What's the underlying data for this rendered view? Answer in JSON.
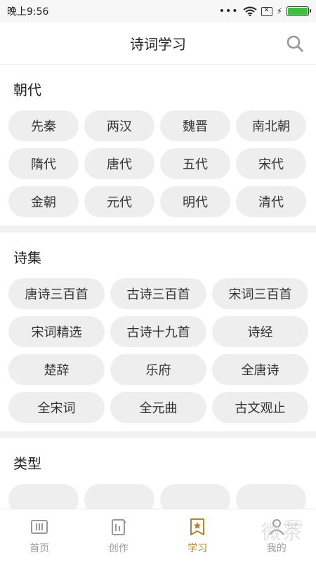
{
  "status_bar": {
    "time": "晚上9:56",
    "dots": "•••",
    "sim_label": "✕",
    "bolt": "⚡"
  },
  "header": {
    "title": "诗词学习",
    "search_icon": "search-icon"
  },
  "sections": [
    {
      "title": "朝代",
      "items": [
        "先秦",
        "两汉",
        "魏晋",
        "南北朝",
        "隋代",
        "唐代",
        "五代",
        "宋代",
        "金朝",
        "元代",
        "明代",
        "清代"
      ]
    },
    {
      "title": "诗集",
      "items": [
        "唐诗三百首",
        "古诗三百首",
        "宋词三百首",
        "宋词精选",
        "古诗十九首",
        "诗经",
        "楚辞",
        "乐府",
        "全唐诗",
        "全宋词",
        "全元曲",
        "古文观止"
      ]
    },
    {
      "title": "类型",
      "items": [
        "",
        "",
        "",
        ""
      ]
    }
  ],
  "tabs": [
    {
      "label": "首页",
      "icon": "home-icon",
      "active": false
    },
    {
      "label": "创作",
      "icon": "edit-icon",
      "active": false
    },
    {
      "label": "学习",
      "icon": "study-icon",
      "active": true
    },
    {
      "label": "我的",
      "icon": "profile-icon",
      "active": false
    }
  ],
  "watermark": {
    "text": "微茶",
    "badge": "CHA"
  },
  "colors": {
    "accent": "#b8832f",
    "chip_bg": "#eeeeee",
    "battery": "#3fbf3f"
  }
}
